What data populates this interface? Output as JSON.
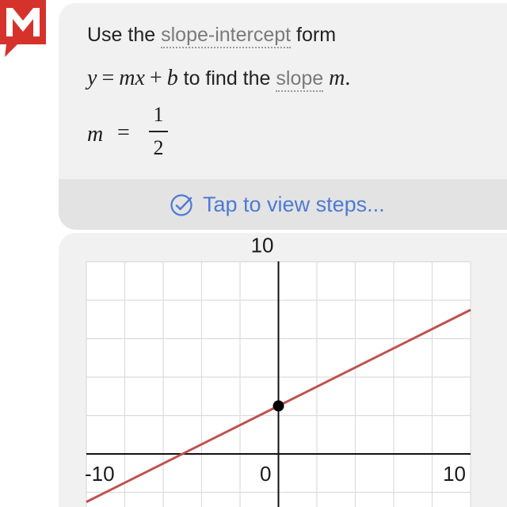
{
  "logo": {
    "icon": "mathway-logo-icon",
    "letter": "M",
    "color": "#d6322c"
  },
  "solution": {
    "line1": {
      "pre": "Use the ",
      "link": "slope-intercept",
      "post": " form"
    },
    "line2": {
      "eq": {
        "y": "y",
        "eq": "=",
        "mx": "mx",
        "plus": "+",
        "b": "b"
      },
      "mid": " to find the ",
      "link": "slope",
      "var": "m",
      "end": "."
    },
    "result": {
      "var": "m",
      "eq": "=",
      "numerator": "1",
      "denominator": "2"
    }
  },
  "steps": {
    "icon": "check-circle-icon",
    "label": "Tap to view steps...",
    "color": "#4d7ad4"
  },
  "chart_data": {
    "type": "line",
    "xlim": [
      -10,
      10
    ],
    "ylim": [
      -5,
      10
    ],
    "grid": true,
    "grid_step": 2,
    "tick_labels": {
      "x_min": "-10",
      "origin": "0",
      "x_max": "10",
      "y_max": "10"
    },
    "series": [
      {
        "x": [
          -10,
          10
        ],
        "y": [
          -2.5,
          7.5
        ],
        "color": "#c0504d"
      }
    ],
    "points": [
      {
        "x": 0,
        "y": 2.5,
        "color": "#000000"
      }
    ]
  }
}
